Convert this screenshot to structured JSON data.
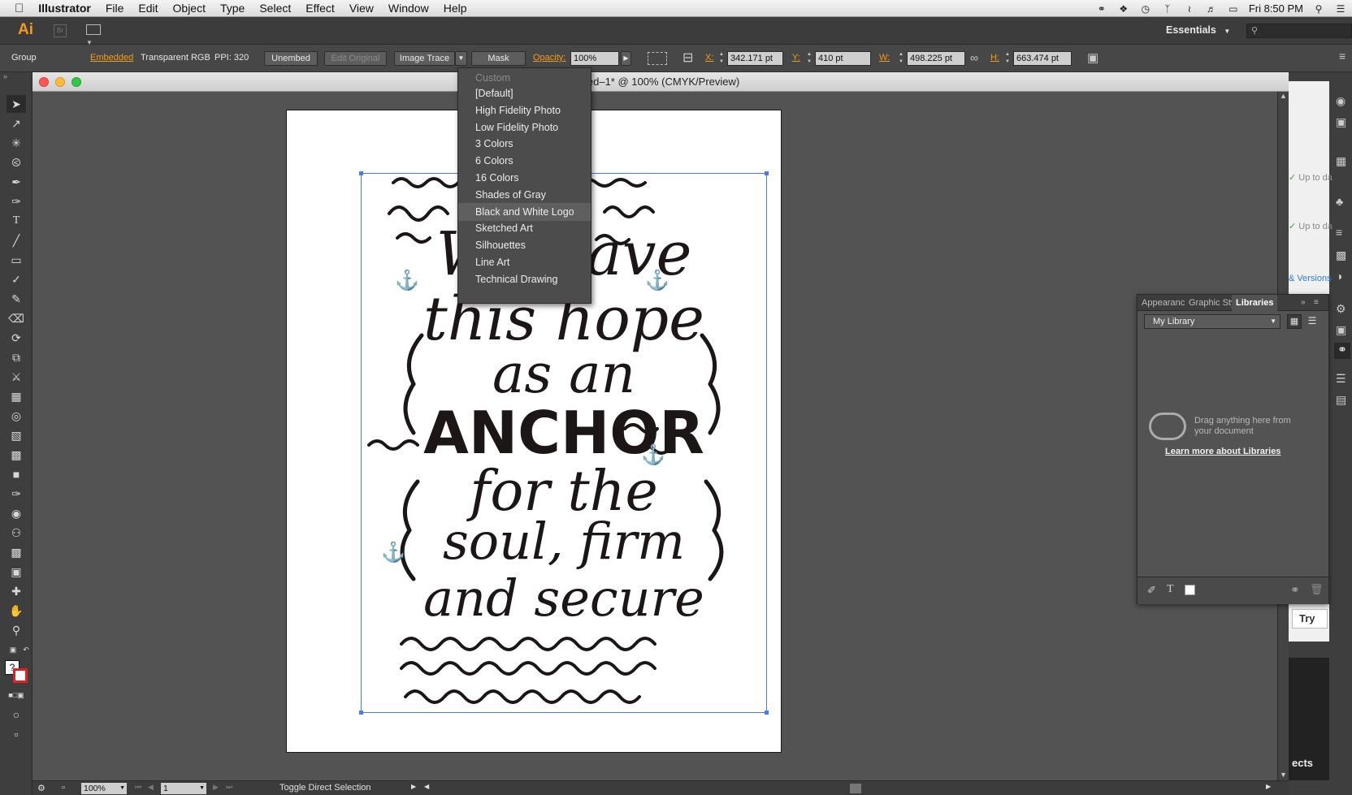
{
  "menubar": {
    "app_name": "Illustrator",
    "items": [
      "File",
      "Edit",
      "Object",
      "Type",
      "Select",
      "Effect",
      "View",
      "Window",
      "Help"
    ],
    "clock": "Fri 8:50 PM"
  },
  "appbar": {
    "logo": "Ai",
    "bridge": "Br",
    "workspace": "Essentials",
    "search_placeholder": ""
  },
  "control_bar": {
    "selection_type": "Group",
    "embedded_label": "Embedded",
    "color_mode": "Transparent RGB",
    "ppi": "PPI: 320",
    "unembed": "Unembed",
    "edit_original": "Edit Original",
    "image_trace": "Image Trace",
    "mask": "Mask",
    "opacity_label": "Opacity:",
    "opacity_value": "100%",
    "x_label": "X:",
    "x_value": "342.171 pt",
    "y_label": "Y:",
    "y_value": "410 pt",
    "w_label": "W:",
    "w_value": "498.225 pt",
    "h_label": "H:",
    "h_value": "663.474 pt"
  },
  "document": {
    "title": "led–1* @ 100% (CMYK/Preview)"
  },
  "trace_presets": {
    "items": [
      {
        "label": "Custom",
        "disabled": true
      },
      {
        "label": "[Default]"
      },
      {
        "label": "High Fidelity Photo"
      },
      {
        "label": "Low Fidelity Photo"
      },
      {
        "label": "3 Colors"
      },
      {
        "label": "6 Colors"
      },
      {
        "label": "16 Colors"
      },
      {
        "label": "Shades of Gray"
      },
      {
        "label": "Black and White Logo",
        "hover": true
      },
      {
        "label": "Sketched Art"
      },
      {
        "label": "Silhouettes"
      },
      {
        "label": "Line Art"
      },
      {
        "label": "Technical Drawing"
      }
    ]
  },
  "artwork": {
    "lines": [
      "We have",
      "this hope",
      "as an",
      "ANCHOR",
      "for the",
      "soul, firm",
      "and secure"
    ]
  },
  "libraries_panel": {
    "tabs": [
      "Appearance",
      "Graphic Styles",
      "Libraries"
    ],
    "selected_library": "My Library",
    "empty_message": "Drag anything here from your document",
    "learn_more": "Learn more about Libraries"
  },
  "cc_panel": {
    "status_1": "Up to da",
    "status_2": "Up to da",
    "versions_link": "& Versions",
    "try_button": "Try",
    "bottom_text": "ects"
  },
  "statusbar": {
    "zoom": "100%",
    "page": "1",
    "status_text": "Toggle Direct Selection"
  },
  "colors": {
    "accent_orange": "#f29b1d",
    "selection_blue": "#4a7cf0",
    "link_blue": "#2e7bd6"
  }
}
